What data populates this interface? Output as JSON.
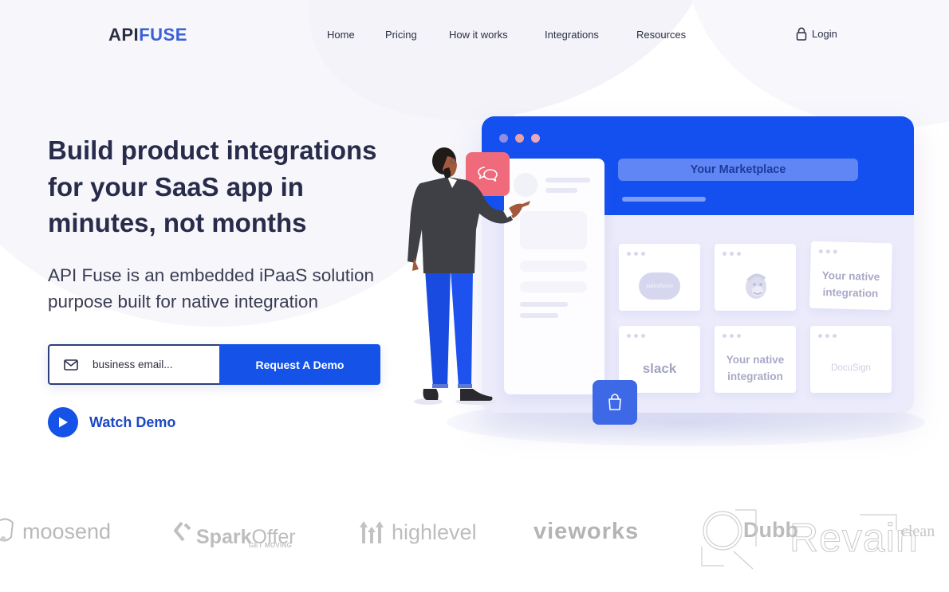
{
  "header": {
    "logo": {
      "part1": "API",
      "part2": "FUSE"
    },
    "nav": [
      {
        "label": "Home"
      },
      {
        "label": "Pricing"
      },
      {
        "label": "How it works"
      },
      {
        "label": "Integrations"
      },
      {
        "label": "Resources"
      }
    ],
    "login_label": "Login",
    "icons": {
      "login": "lock-icon"
    }
  },
  "hero": {
    "headline": "Build product integrations for your SaaS app in minutes, not months",
    "subheadline": "API Fuse is an embedded iPaaS solution purpose built for native integration",
    "email_placeholder": "business email...",
    "email_value": "",
    "request_button": "Request A Demo",
    "watch_demo": "Watch Demo",
    "icons": {
      "email": "mail-icon",
      "watch": "play-icon"
    }
  },
  "illustration": {
    "marketplace_title": "Your Marketplace",
    "tiles": [
      {
        "label": "salesforce",
        "kind": "salesforce-logo"
      },
      {
        "label": "",
        "kind": "mailchimp-logo"
      },
      {
        "label": "Your native integration",
        "kind": "text"
      },
      {
        "label": "slack",
        "kind": "text"
      },
      {
        "label": "Your native integration",
        "kind": "text"
      },
      {
        "label": "DocuSign",
        "kind": "text"
      }
    ],
    "badges": {
      "chat": "chat-bubbles-icon",
      "bag": "shopping-bag-icon"
    }
  },
  "customer_logos": [
    {
      "name": "moosend"
    },
    {
      "name": "Spark",
      "name_light": "Offer",
      "tagline": "GET MOVING"
    },
    {
      "name": "highlevel"
    },
    {
      "name": "vieworks"
    },
    {
      "name": "Dubb"
    },
    {
      "name": "clean"
    }
  ],
  "watermark": {
    "text": "Revain"
  },
  "colors": {
    "brand_blue": "#1452e8",
    "logo_blue": "#3b5fd6",
    "heading": "#282c4a",
    "chat_badge": "#ef6a7a",
    "window_header": "#1450f0"
  }
}
